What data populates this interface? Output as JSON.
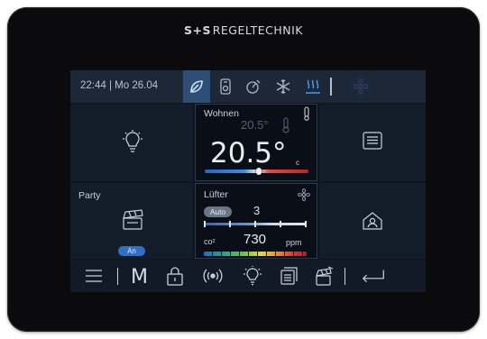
{
  "brand": {
    "logo": "S+S",
    "name": "REGELTECHNIK"
  },
  "statusbar": {
    "datetime": "22:44 | Mo 26.04",
    "icons": [
      "leaf-icon",
      "thermostat-icon",
      "timer-icon",
      "snowflake-icon",
      "heating-icon",
      "fan-icon"
    ],
    "active_icon": "leaf-icon"
  },
  "room": {
    "title": "Wohnen",
    "setpoint": "20.5°",
    "temperature": "20.5°",
    "unit": "c",
    "temperature_bar_fraction": 0.52
  },
  "party": {
    "label": "Party",
    "badge": "An"
  },
  "ventilation": {
    "label": "Lüfter",
    "mode": "Auto",
    "level": "3",
    "co2_label": "co²",
    "co2_value": "730",
    "co2_unit": "ppm"
  },
  "toolbar": {
    "mode_letter": "M",
    "items": [
      "menu-icon",
      "mode-m",
      "lock-icon",
      "broadcast-icon",
      "light-icon",
      "blinds-icon",
      "scene-icon",
      "back-icon"
    ]
  },
  "colors": {
    "accent": "#2f6fc9",
    "background": "#0e1521"
  }
}
